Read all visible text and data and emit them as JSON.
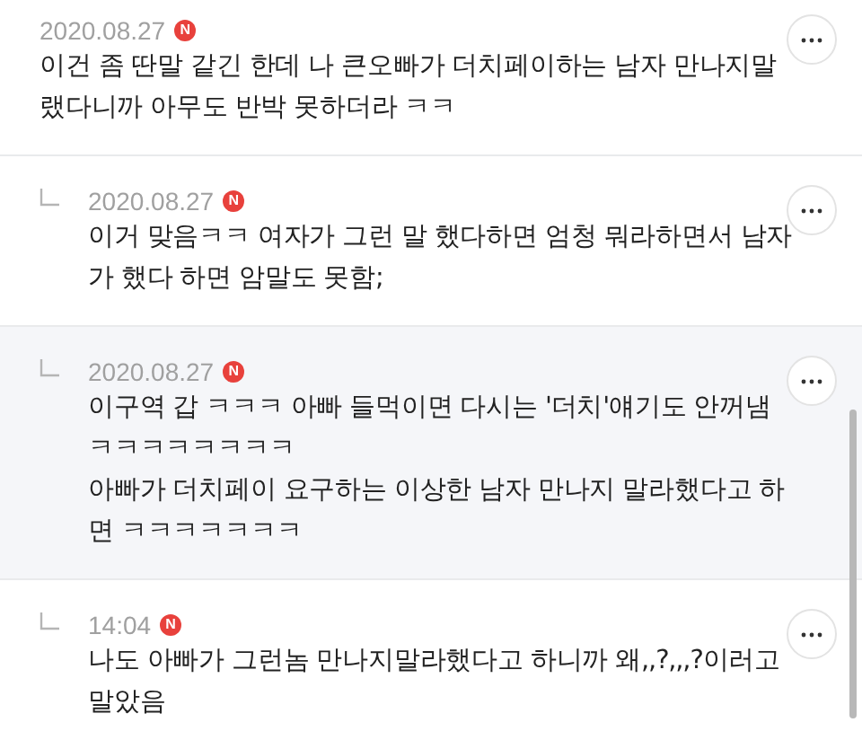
{
  "comments": [
    {
      "reply": false,
      "highlighted": false,
      "date": "2020.08.27",
      "badge": "N",
      "lines": [
        "이건 좀 딴말 같긴 한데 나 큰오빠가 더치페이하는 남자 만나지말",
        "랬다니까 아무도 반박 못하더라 ㅋㅋ"
      ]
    },
    {
      "reply": true,
      "highlighted": false,
      "date": "2020.08.27",
      "badge": "N",
      "lines": [
        "이거 맞음ㅋㅋ 여자가 그런 말 했다하면 엄청 뭐라하면서 남자",
        "가 했다 하면 암말도 못함;"
      ]
    },
    {
      "reply": true,
      "highlighted": true,
      "date": "2020.08.27",
      "badge": "N",
      "lines": [
        "이구역 갑 ㅋㅋㅋ 아빠 들먹이면 다시는 '더치'얘기도 안꺼냄",
        "ㅋㅋㅋㅋㅋㅋㅋㅋ",
        "아빠가 더치페이 요구하는 이상한 남자 만나지 말라했다고 하",
        "면 ㅋㅋㅋㅋㅋㅋㅋ"
      ]
    },
    {
      "reply": true,
      "highlighted": false,
      "date": "14:04",
      "badge": "N",
      "lines": [
        "나도 아빠가 그런놈 만나지말라했다고 하니까 왜,,?,,,?이러고",
        "말았음"
      ]
    }
  ]
}
